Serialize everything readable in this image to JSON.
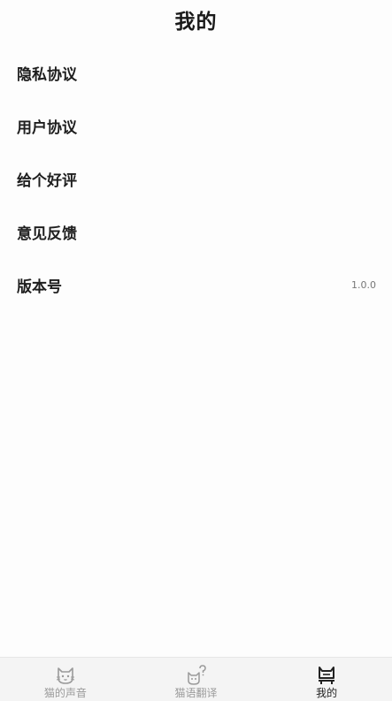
{
  "header": {
    "title": "我的"
  },
  "menu": [
    {
      "label": "隐私协议",
      "value": ""
    },
    {
      "label": "用户协议",
      "value": ""
    },
    {
      "label": "给个好评",
      "value": ""
    },
    {
      "label": "意见反馈",
      "value": ""
    },
    {
      "label": "版本号",
      "value": "1.0.0"
    }
  ],
  "tabbar": {
    "active": "mine",
    "tabs": [
      {
        "label": "猫的声音",
        "icon": "cat-face-icon"
      },
      {
        "label": "猫语翻译",
        "icon": "cat-question-icon"
      },
      {
        "label": "我的",
        "icon": "cat-profile-icon"
      }
    ]
  },
  "colors": {
    "active": "#222222",
    "inactive": "#9a9a9a",
    "tabbar_bg": "#f4f4f4"
  }
}
